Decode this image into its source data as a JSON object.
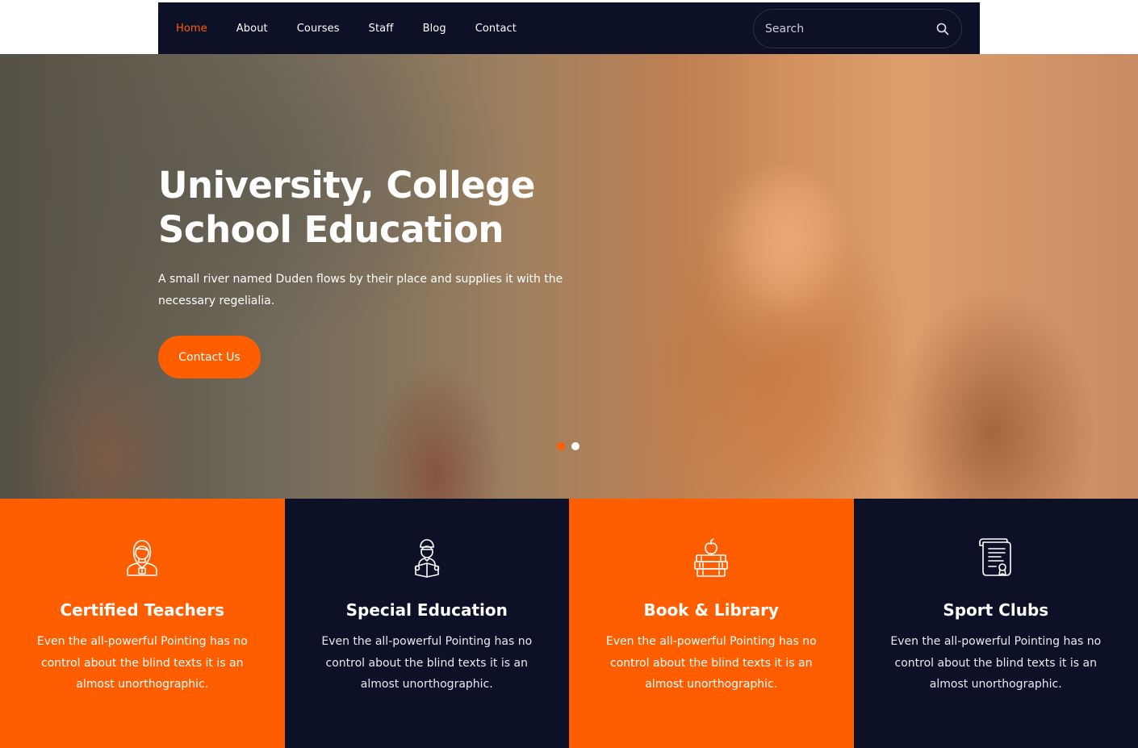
{
  "nav": {
    "items": [
      {
        "label": "Home",
        "active": true
      },
      {
        "label": "About",
        "active": false
      },
      {
        "label": "Courses",
        "active": false
      },
      {
        "label": "Staff",
        "active": false
      },
      {
        "label": "Blog",
        "active": false
      },
      {
        "label": "Contact",
        "active": false
      }
    ],
    "search": {
      "placeholder": "Search",
      "icon": "search-icon"
    }
  },
  "hero": {
    "title_line1": "University, College",
    "title_line2": "School Education",
    "subtitle": "A small river named Duden flows by their place and supplies it with the necessary regelialia.",
    "button_label": "Contact Us",
    "slides": {
      "count": 2,
      "active_index": 0
    }
  },
  "features": [
    {
      "icon": "teacher-icon",
      "title": "Certified Teachers",
      "text": "Even the all-powerful Pointing has no control about the blind texts it is an almost unorthographic.",
      "bg": "#ff5e00"
    },
    {
      "icon": "student-reading-icon",
      "title": "Special Education",
      "text": "Even the all-powerful Pointing has no control about the blind texts it is an almost unorthographic.",
      "bg": "#0d1128"
    },
    {
      "icon": "books-apple-icon",
      "title": "Book & Library",
      "text": "Even the all-powerful Pointing has no control about the blind texts it is an almost unorthographic.",
      "bg": "#ff5e00"
    },
    {
      "icon": "certificate-icon",
      "title": "Sport Clubs",
      "text": "Even the all-powerful Pointing has no control about the blind texts it is an almost unorthographic.",
      "bg": "#0d1128"
    }
  ],
  "colors": {
    "accent": "#ff5e00",
    "navy": "#0d1128",
    "text": "#ffffff"
  }
}
